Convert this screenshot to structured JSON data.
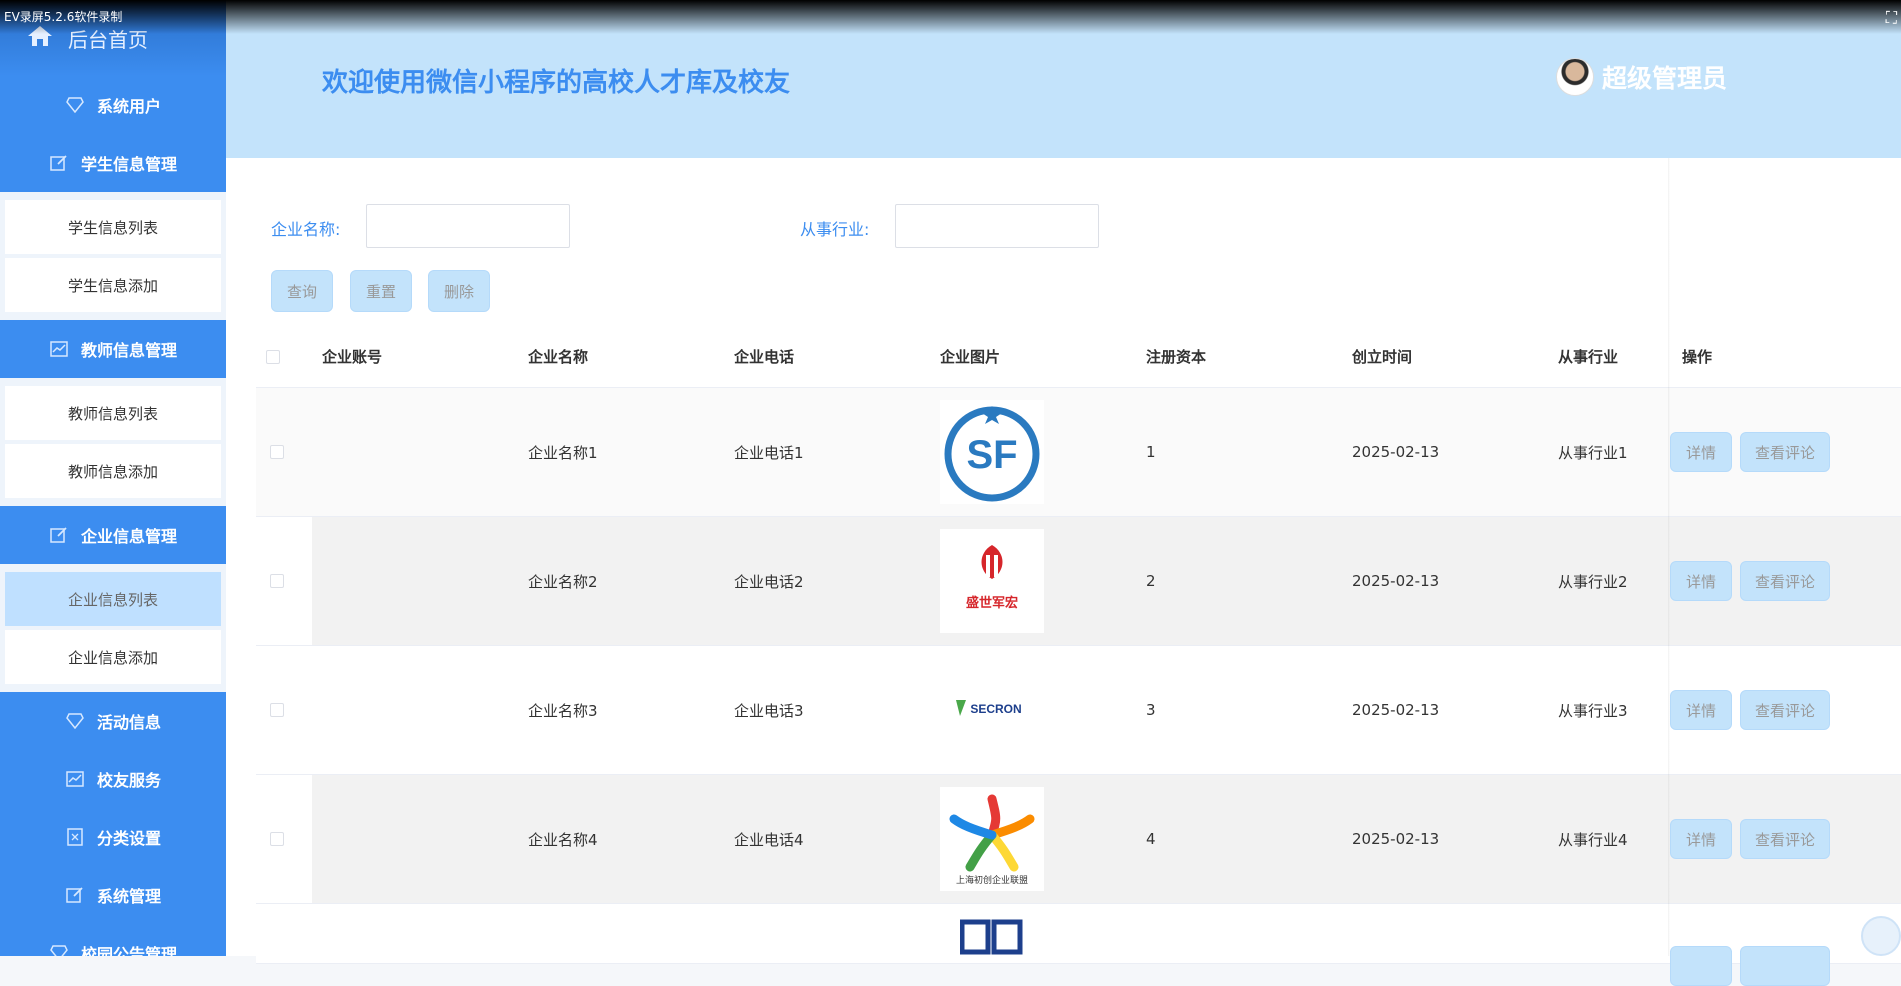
{
  "recorder": {
    "label": "EV录屏5.2.6软件录制"
  },
  "sidebar": {
    "home": "后台首页",
    "items": [
      {
        "label": "系统用户",
        "icon": "diamond-icon"
      },
      {
        "label": "学生信息管理",
        "icon": "edit-icon",
        "subs": [
          "学生信息列表",
          "学生信息添加"
        ]
      },
      {
        "label": "教师信息管理",
        "icon": "chart-icon",
        "subs": [
          "教师信息列表",
          "教师信息添加"
        ]
      },
      {
        "label": "企业信息管理",
        "icon": "edit-icon",
        "subs": [
          "企业信息列表",
          "企业信息添加"
        ],
        "active_sub": 0
      },
      {
        "label": "活动信息",
        "icon": "diamond-icon"
      },
      {
        "label": "校友服务",
        "icon": "chart-icon"
      },
      {
        "label": "分类设置",
        "icon": "bookmark-icon"
      },
      {
        "label": "系统管理",
        "icon": "edit-icon"
      },
      {
        "label": "校园公告管理",
        "icon": "diamond-icon"
      }
    ]
  },
  "header": {
    "welcome": "欢迎使用微信小程序的高校人才库及校友",
    "user": "超级管理员"
  },
  "search": {
    "company_label": "企业名称:",
    "industry_label": "从事行业:",
    "company_value": "",
    "industry_value": "",
    "buttons": {
      "query": "查询",
      "reset": "重置",
      "delete": "删除"
    }
  },
  "table": {
    "headers": [
      "企业账号",
      "企业名称",
      "企业电话",
      "企业图片",
      "注册资本",
      "创立时间",
      "从事行业",
      "操作"
    ],
    "rows": [
      {
        "account": "",
        "name": "企业名称1",
        "phone": "企业电话1",
        "logo": "sf-logo",
        "capital": "1",
        "date": "2025-02-13",
        "industry": "从事行业1"
      },
      {
        "account": "",
        "name": "企业名称2",
        "phone": "企业电话2",
        "logo": "shengshi-logo",
        "capital": "2",
        "date": "2025-02-13",
        "industry": "从事行业2",
        "logo_text": "盛世军宏"
      },
      {
        "account": "",
        "name": "企业名称3",
        "phone": "企业电话3",
        "logo": "secron-logo",
        "capital": "3",
        "date": "2025-02-13",
        "industry": "从事行业3",
        "logo_text": "SECRON"
      },
      {
        "account": "",
        "name": "企业名称4",
        "phone": "企业电话4",
        "logo": "star-logo",
        "capital": "4",
        "date": "2025-02-13",
        "industry": "从事行业4",
        "logo_text": "上海初创企业联盟"
      }
    ],
    "actions": {
      "detail": "详情",
      "comments": "查看评论"
    }
  }
}
